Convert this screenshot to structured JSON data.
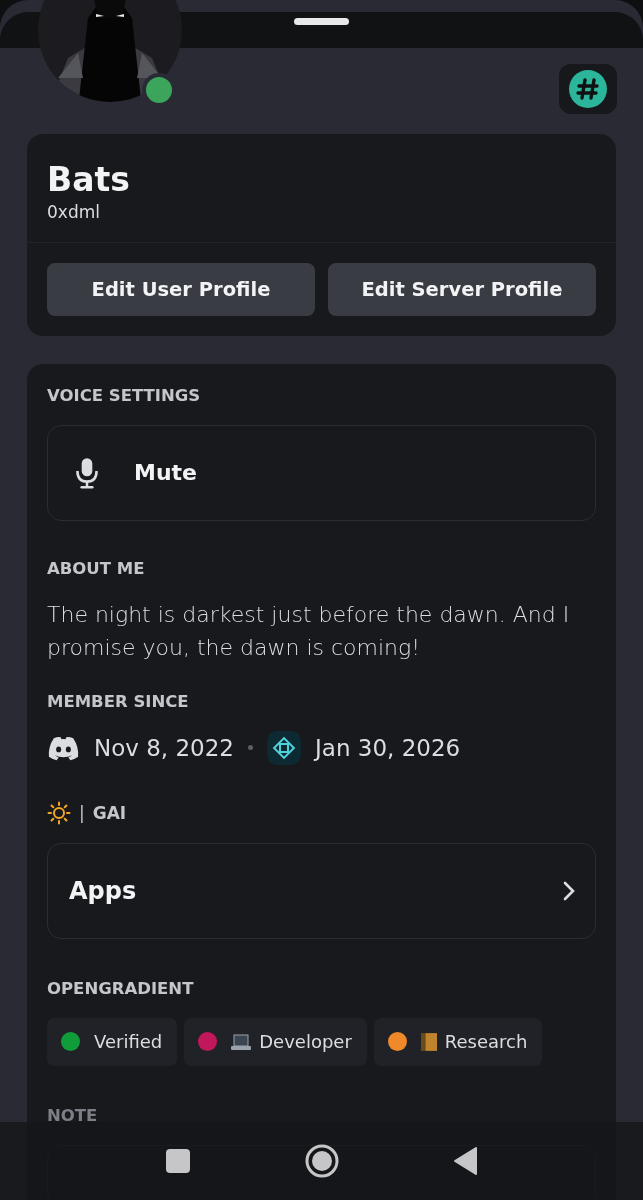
{
  "profile": {
    "online": true,
    "display_name": "Bats",
    "username": "0xdml",
    "buttons": [
      "Edit User Profile",
      "Edit Server Profile"
    ]
  },
  "voice_settings": {
    "heading": "VOICE SETTINGS",
    "mute_label": "Mute"
  },
  "about_me": {
    "heading": "ABOUT ME",
    "text": "The night is darkest just before the dawn. And I promise you, the dawn is coming!"
  },
  "member_since": {
    "heading": "MEMBER SINCE",
    "dates": [
      "Nov 8, 2022",
      "Jan 30, 2026"
    ]
  },
  "server_tag": {
    "separator": "|",
    "text": "GAI"
  },
  "apps": {
    "label": "Apps"
  },
  "roles": {
    "heading": "OPENGRADIENT",
    "items": [
      {
        "label": "Verified",
        "color": "#119c3a",
        "kind": "plain"
      },
      {
        "label": "Developer",
        "color": "#c2185b",
        "kind": "laptop"
      },
      {
        "label": "Research",
        "color": "#f0892a",
        "kind": "book"
      }
    ]
  },
  "note": {
    "heading": "NOTE"
  }
}
